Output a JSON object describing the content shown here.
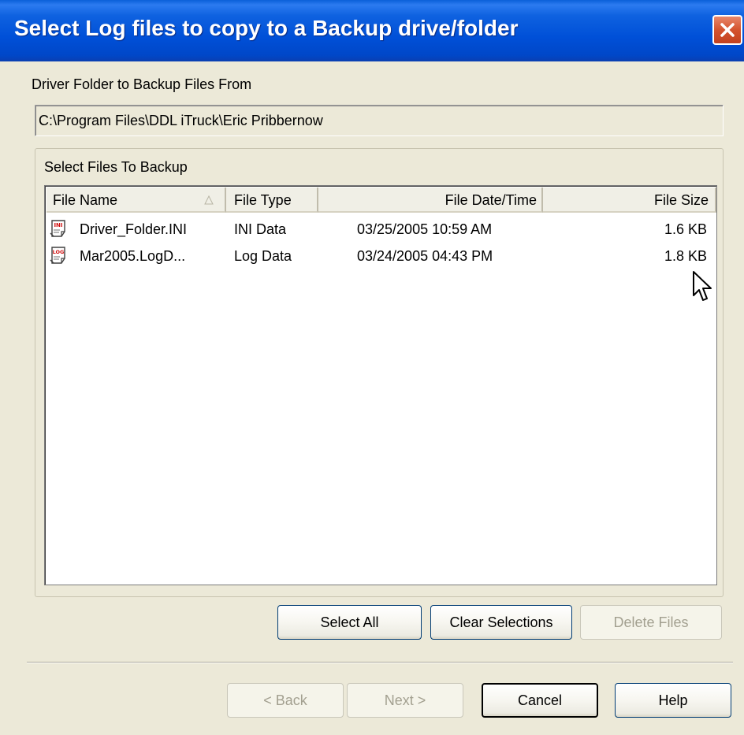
{
  "window": {
    "title": "Select Log files to copy to a Backup drive/folder"
  },
  "folder": {
    "label": "Driver Folder to Backup Files From",
    "path": "C:\\Program Files\\DDL iTruck\\Eric Pribbernow"
  },
  "files_group": {
    "label": "Select Files To Backup",
    "columns": [
      "File Name",
      "File Type",
      "File Date/Time",
      "File Size"
    ],
    "sort_column": "File Name",
    "rows": [
      {
        "icon": "ini-file-icon",
        "icon_label": "INI",
        "name": "Driver_Folder.INI",
        "type": "INI Data",
        "datetime": "03/25/2005  10:59 AM",
        "size": "1.6 KB"
      },
      {
        "icon": "log-file-icon",
        "icon_label": "LOG",
        "name": "Mar2005.LogD...",
        "type": "Log Data",
        "datetime": "03/24/2005  04:43 PM",
        "size": "1.8 KB"
      }
    ]
  },
  "list_buttons": {
    "select_all": "Select All",
    "clear_selections": "Clear Selections",
    "delete_files": "Delete Files"
  },
  "wizard_buttons": {
    "back": "< Back",
    "next": "Next >",
    "cancel": "Cancel",
    "help": "Help"
  },
  "colors": {
    "title_bar": "#0050d8",
    "close_button": "#d4532e",
    "dialog_background": "#ece9d8",
    "icon_red": "#d01010"
  }
}
